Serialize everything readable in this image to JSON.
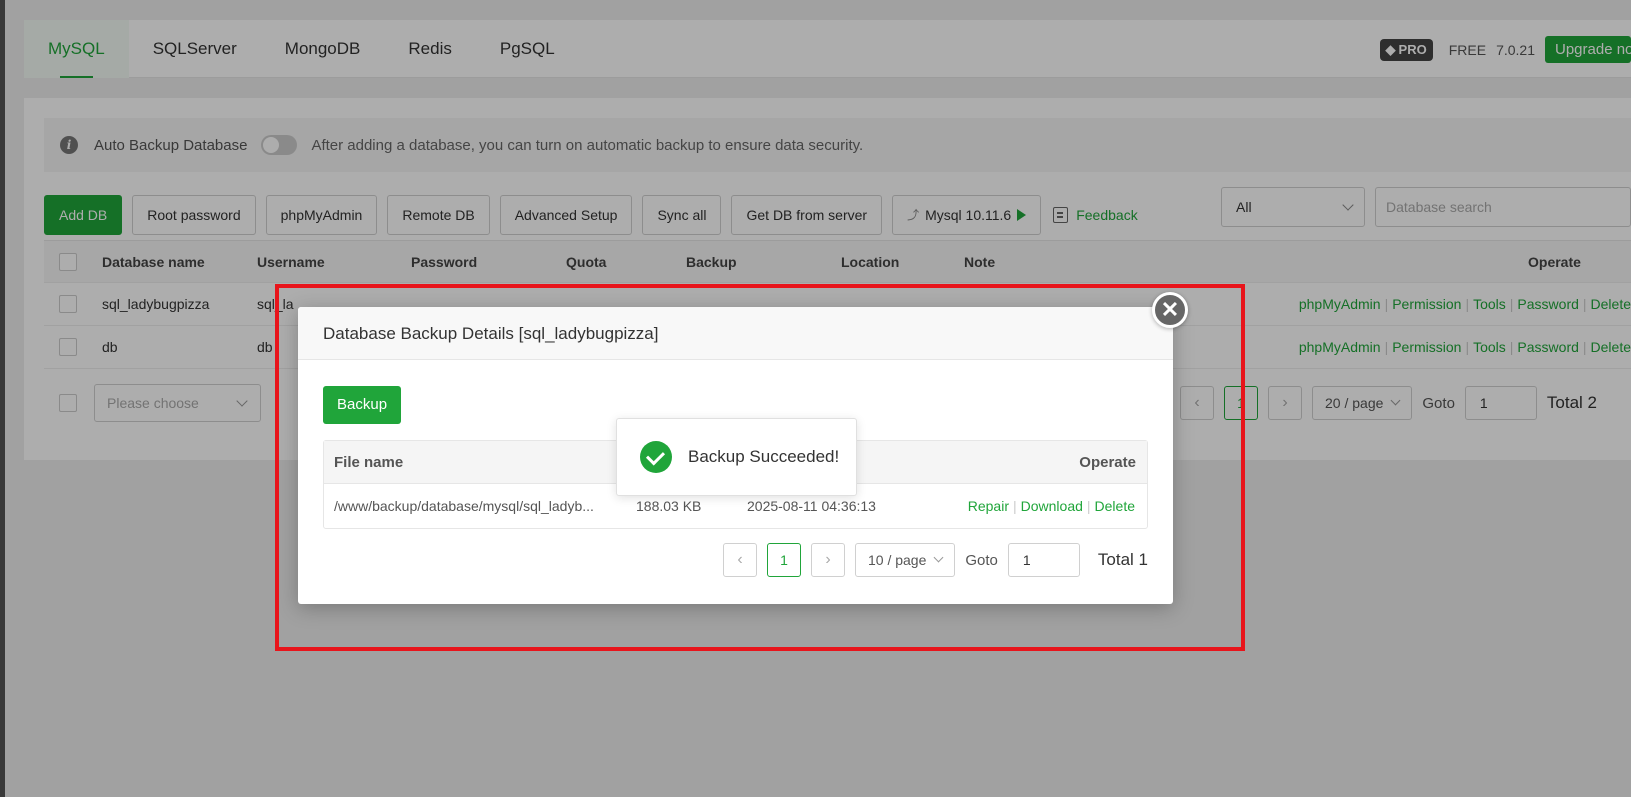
{
  "tabs": [
    "MySQL",
    "SQLServer",
    "MongoDB",
    "Redis",
    "PgSQL"
  ],
  "topright": {
    "pro": "PRO",
    "free": "FREE",
    "version": "7.0.21",
    "upgrade": "Upgrade now"
  },
  "info": {
    "label": "Auto Backup Database",
    "text": "After adding a database, you can turn on automatic backup to ensure data security."
  },
  "toolbar": {
    "add_db": "Add DB",
    "root_password": "Root password",
    "phpmyadmin": "phpMyAdmin",
    "remote_db": "Remote DB",
    "advanced_setup": "Advanced Setup",
    "sync_all": "Sync all",
    "get_db": "Get DB from server",
    "mysql_version": "Mysql 10.11.6",
    "feedback": "Feedback"
  },
  "filter": {
    "selected": "All",
    "search_placeholder": "Database search"
  },
  "table": {
    "headers": [
      "Database name",
      "Username",
      "Password",
      "Quota",
      "Backup",
      "Location",
      "Note",
      "Operate"
    ],
    "rows": [
      {
        "name": "sql_ladybugpizza",
        "user": "sql_la"
      },
      {
        "name": "db",
        "user": "db"
      }
    ],
    "ops": [
      "phpMyAdmin",
      "Permission",
      "Tools",
      "Password",
      "Delete"
    ]
  },
  "bulk": {
    "placeholder": "Please choose"
  },
  "pager": {
    "page": "1",
    "size": "20 / page",
    "goto": "Goto",
    "goto_value": "1",
    "total": "Total 2"
  },
  "modal": {
    "title": "Database Backup Details [sql_ladybugpizza]",
    "backup_btn": "Backup",
    "headers": {
      "file": "File name",
      "operate": "Operate"
    },
    "row": {
      "file": "/www/backup/database/mysql/sql_ladyb...",
      "size": "188.03 KB",
      "time": "2025-08-11 04:36:13"
    },
    "ops": [
      "Repair",
      "Download",
      "Delete"
    ],
    "pager": {
      "page": "1",
      "size": "10 / page",
      "goto": "Goto",
      "goto_value": "1",
      "total": "Total 1"
    }
  },
  "toast": {
    "text": "Backup Succeeded!"
  },
  "colors": {
    "accent": "#20a53a",
    "highlight": "#e8141b"
  }
}
